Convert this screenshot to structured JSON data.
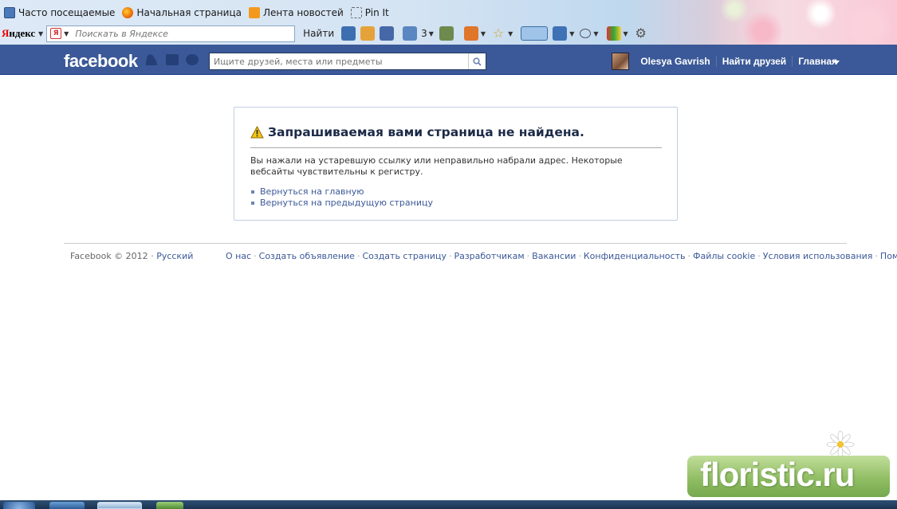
{
  "browser": {
    "bookmarks": [
      {
        "label": "Часто посещаемые",
        "icon": "page-icon"
      },
      {
        "label": "Начальная страница",
        "icon": "firefox-icon"
      },
      {
        "label": "Лента новостей",
        "icon": "rss-icon"
      },
      {
        "label": "Pin It",
        "icon": "pin-icon"
      }
    ],
    "yandex": {
      "logo_first": "Я",
      "logo_rest": "ндекс",
      "search_placeholder": "Поискать в Яндексе",
      "find_label": "Найти",
      "mail_count": "3"
    }
  },
  "facebook": {
    "logo": "facebook",
    "search_placeholder": "Ищите друзей, места или предметы",
    "user_name": "Olesya Gavrish",
    "nav": {
      "find_friends": "Найти друзей",
      "home": "Главная"
    }
  },
  "error": {
    "title": "Запрашиваемая вами страница не найдена.",
    "message": "Вы нажали на устаревшую ссылку или неправильно набрали адрес. Некоторые вебсайты чувствительны к регистру.",
    "links": [
      "Вернуться на главную",
      "Вернуться на предыдущую страницу"
    ]
  },
  "footer": {
    "copyright": "Facebook © 2012",
    "separator": "·",
    "language": "Русский",
    "links": [
      "О нас",
      "Создать объявление",
      "Создать страницу",
      "Разработчикам",
      "Вакансии",
      "Конфиденциальность",
      "Файлы cookie",
      "Условия использования",
      "Помощь"
    ]
  },
  "watermark": {
    "text": "floristic.ru"
  },
  "colors": {
    "fb_blue": "#3b5998",
    "link": "#3b5998",
    "title": "#1c2a47"
  }
}
